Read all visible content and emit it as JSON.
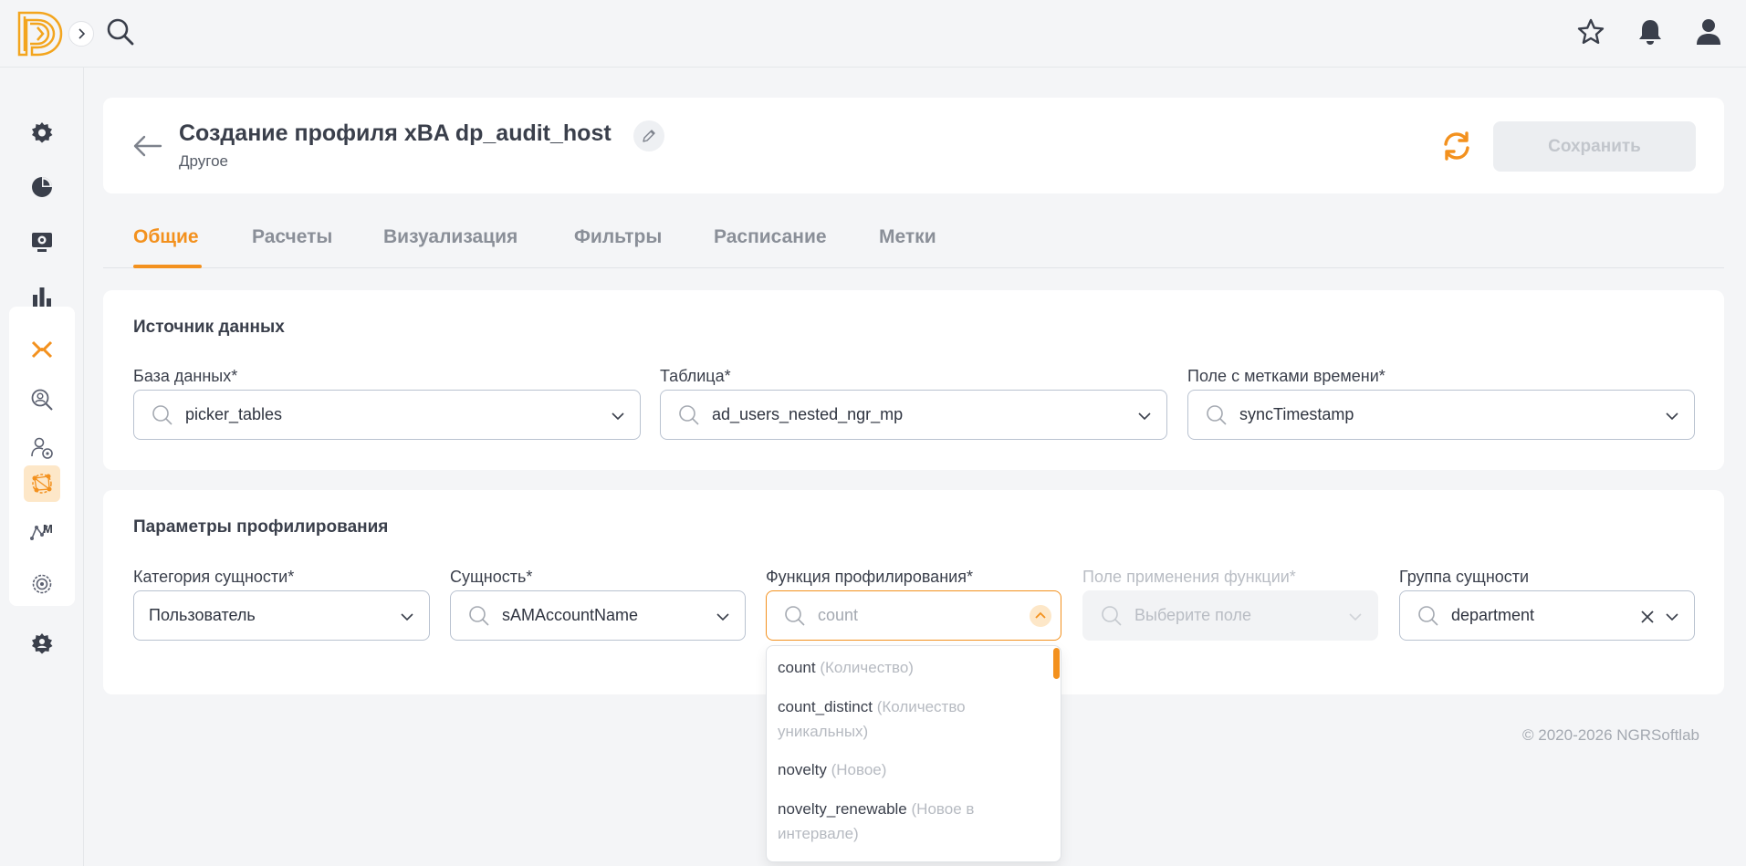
{
  "header": {
    "title": "Создание профиля xBA dp_audit_host",
    "subtitle": "Другое",
    "save_label": "Сохранить"
  },
  "tabs": [
    {
      "label": "Общие",
      "active": true
    },
    {
      "label": "Расчеты"
    },
    {
      "label": "Визуализация"
    },
    {
      "label": "Фильтры"
    },
    {
      "label": "Расписание"
    },
    {
      "label": "Метки"
    }
  ],
  "data_source": {
    "title": "Источник данных",
    "database": {
      "label": "База данных*",
      "value": "picker_tables"
    },
    "table": {
      "label": "Таблица*",
      "value": "ad_users_nested_ngr_mp"
    },
    "timestamp": {
      "label": "Поле с метками времени*",
      "value": "syncTimestamp"
    }
  },
  "profiling": {
    "title": "Параметры профилирования",
    "entity_category": {
      "label": "Категория сущности*",
      "value": "Пользователь"
    },
    "entity": {
      "label": "Сущность*",
      "value": "sAMAccountName"
    },
    "function": {
      "label": "Функция профилирования*",
      "placeholder": "count"
    },
    "apply_field": {
      "label": "Поле применения функции*",
      "placeholder": "Выберите поле"
    },
    "entity_group": {
      "label": "Группа сущности",
      "value": "department"
    }
  },
  "dropdown": {
    "options": [
      {
        "name": "count",
        "hint": "(Количество)"
      },
      {
        "name": "count_distinct",
        "hint": "(Количество уникальных)"
      },
      {
        "name": "novelty",
        "hint": "(Новое)"
      },
      {
        "name": "novelty_renewable",
        "hint": "(Новое в интервале)"
      }
    ]
  },
  "footer": {
    "copyright": "© 2020-2026 NGRSoftlab"
  },
  "colors": {
    "accent": "#f3911e",
    "rail_active": "#fde7c8"
  },
  "icons": {
    "top": [
      "search-icon",
      "star-icon",
      "bell-icon",
      "user-icon"
    ],
    "rail": [
      "settings-icon",
      "pie-chart-icon",
      "monitor-icon",
      "bar-chart-icon",
      "xba-icon",
      "user-search-icon",
      "user-settings-icon",
      "network-icon",
      "ml-icon",
      "gear-icon",
      "admin-icon"
    ]
  }
}
